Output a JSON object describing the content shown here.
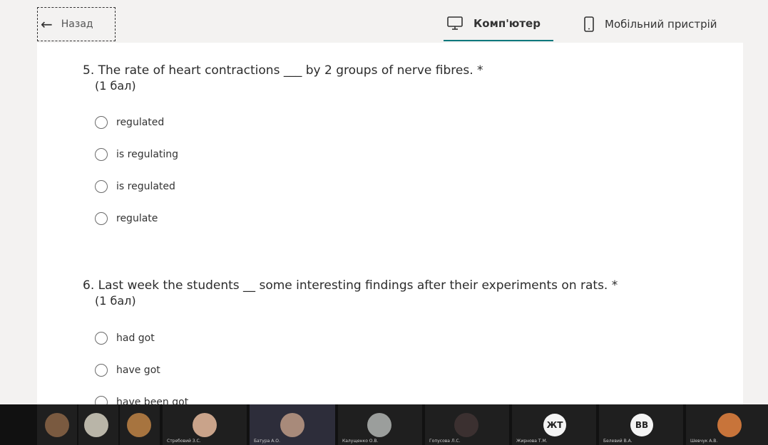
{
  "header": {
    "back_label": "Назад",
    "tabs": [
      {
        "label": "Комп'ютер",
        "icon": "monitor-icon",
        "active": true
      },
      {
        "label": "Мобільний пристрій",
        "icon": "phone-icon",
        "active": false
      }
    ]
  },
  "questions": [
    {
      "title": "5. The rate of heart contractions ___ by 2 groups of nerve fibres. *",
      "points": "(1 бал)",
      "options": [
        "regulated",
        "is regulating",
        "is regulated",
        "regulate"
      ]
    },
    {
      "title": "6. Last week the students __ some interesting findings after their experiments on rats. *",
      "points": "(1 бал)",
      "options": [
        "had got",
        "have got",
        "have been got"
      ]
    }
  ],
  "participants": [
    {
      "name": "",
      "color": "#7a5a40"
    },
    {
      "name": "",
      "color": "#b9b5a8"
    },
    {
      "name": "",
      "color": "#a7743f"
    },
    {
      "name": "Стребовий З.С.",
      "color": "#c9a38a"
    },
    {
      "name": "Батура А.О.",
      "color": "#a88a7a"
    },
    {
      "name": "Калущенко О.В.",
      "color": "#9b9e9c"
    },
    {
      "name": "Гопусова Л.С.",
      "color": "#3b3030"
    },
    {
      "name": "Жирнова Т.М.",
      "initials": "ЖТ",
      "color": "#f4f4f4"
    },
    {
      "name": "Белевий В.А.",
      "initials": "ВВ",
      "color": "#f4f4f4"
    },
    {
      "name": "Шевчук А.В.",
      "color": "#c8743a"
    }
  ]
}
